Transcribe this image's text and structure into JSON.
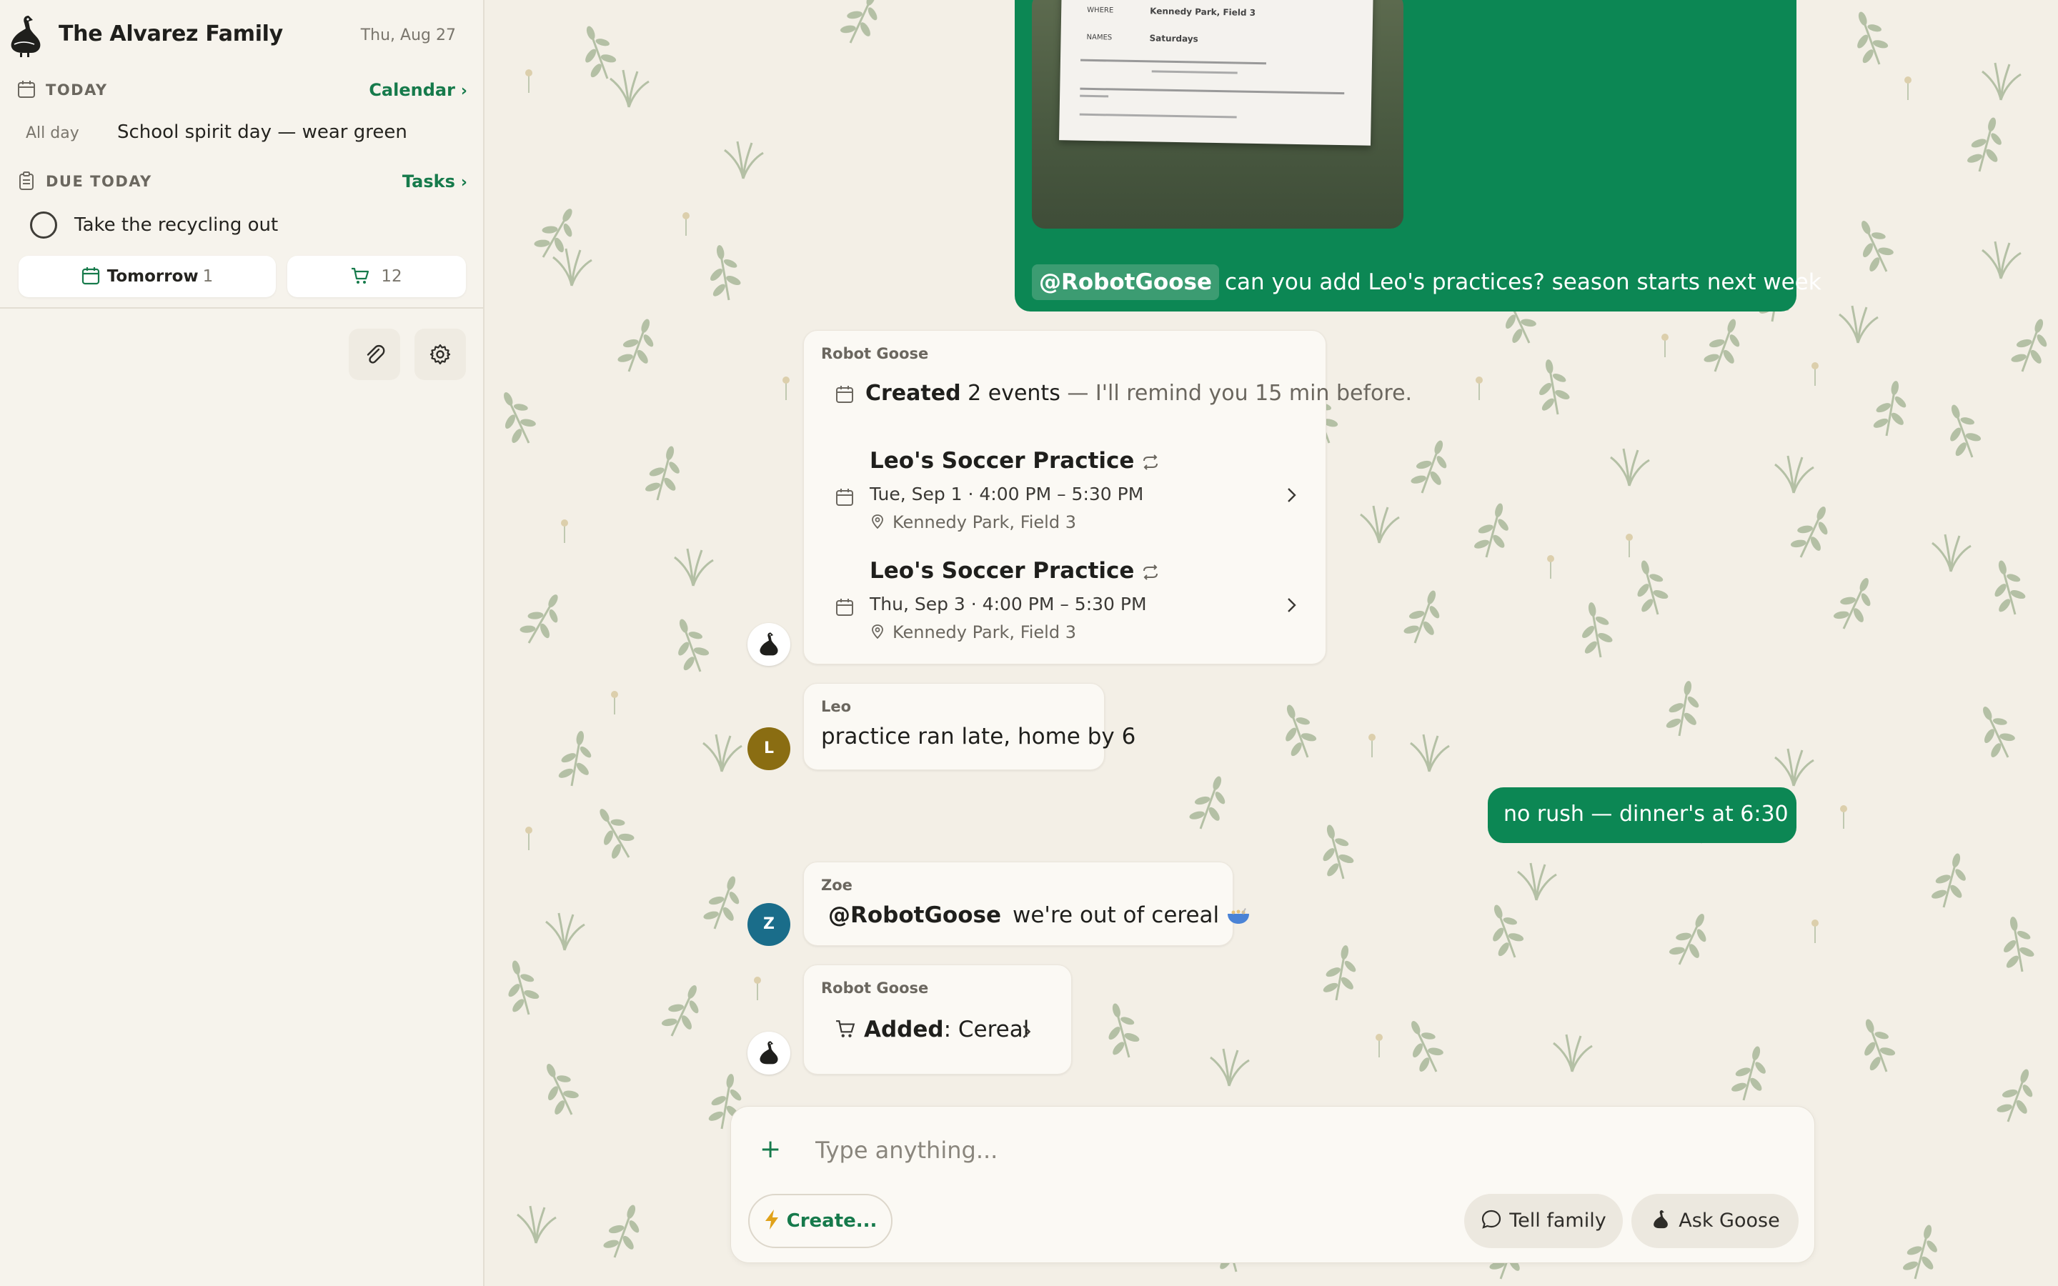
{
  "sidebar": {
    "family_name": "The Alvarez Family",
    "date": "Thu, Aug 27",
    "today": {
      "label": "TODAY",
      "link": "Calendar",
      "event": {
        "when": "All day",
        "what": "School spirit day — wear green"
      }
    },
    "due": {
      "label": "DUE TODAY",
      "link": "Tasks",
      "task": "Take the recycling out"
    },
    "chips": {
      "tomorrow_label": "Tomorrow",
      "tomorrow_count": "1",
      "shopping_count": "12"
    },
    "icons": [
      "goose-logo-icon",
      "calendar-icon",
      "clipboard-icon",
      "cart-icon",
      "paperclip-icon",
      "gear-icon"
    ]
  },
  "messages": {
    "photo_message": {
      "mention": "@RobotGoose",
      "text": "can you add Leo's practices? season starts next week",
      "photo_lines": [
        "WHERE",
        "Kennedy Park, Field 3",
        "NAMES",
        "Saturdays"
      ]
    },
    "goose_events": {
      "sender": "Robot Goose",
      "summary_strong": "Created",
      "summary_count": "2 events",
      "summary_rest": "— I'll remind you 15 min before.",
      "events": [
        {
          "title": "Leo's Soccer Practice",
          "time": "Tue, Sep 1 · 4:00 PM – 5:30 PM",
          "location": "Kennedy Park, Field 3"
        },
        {
          "title": "Leo's Soccer Practice",
          "time": "Thu, Sep 3 · 4:00 PM – 5:30 PM",
          "location": "Kennedy Park, Field 3"
        }
      ]
    },
    "leo": {
      "sender": "Leo",
      "avatar": "L",
      "avatar_color": "#8a6d12",
      "text": "practice ran late, home by 6"
    },
    "me_reply": {
      "text": "no rush — dinner's at 6:30"
    },
    "zoe": {
      "sender": "Zoe",
      "avatar": "Z",
      "avatar_color": "#1a6d8a",
      "mention": "@RobotGoose",
      "text": "we're out of cereal"
    },
    "goose_added": {
      "sender": "Robot Goose",
      "strong": "Added",
      "text": ": Cereal"
    }
  },
  "composer": {
    "placeholder": "Type anything...",
    "create_label": "Create...",
    "tell_label": "Tell family",
    "ask_label": "Ask Goose"
  },
  "colors": {
    "accent": "#0c8754",
    "link": "#167a4b",
    "background": "#f3efe6",
    "sidebar": "#f6f3ec",
    "create_bolt": "#e0a21a"
  }
}
